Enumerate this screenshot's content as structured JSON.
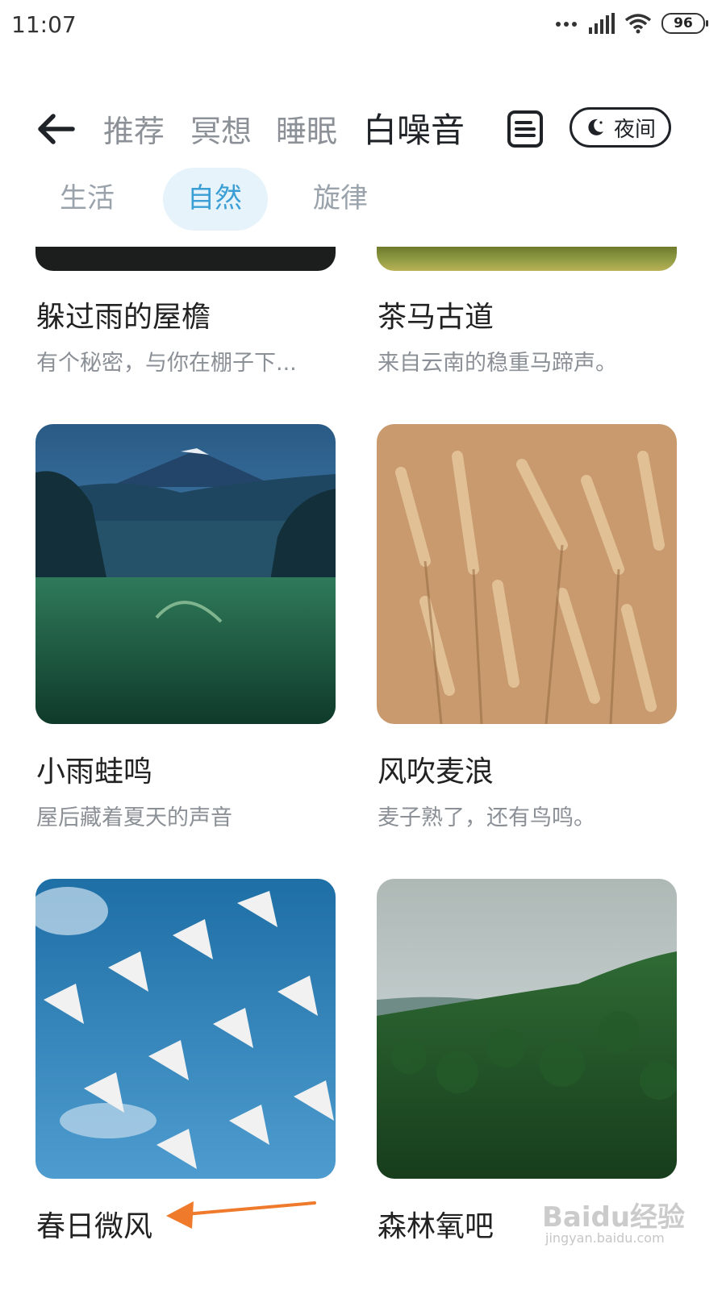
{
  "status_bar": {
    "time": "11:07",
    "battery": "96",
    "icons": [
      "dots-icon",
      "signal-icon",
      "wifi-icon",
      "battery-icon"
    ]
  },
  "header": {
    "tabs": [
      {
        "label": "推荐",
        "active": false
      },
      {
        "label": "冥想",
        "active": false
      },
      {
        "label": "睡眠",
        "active": false
      },
      {
        "label": "白噪音",
        "active": true
      }
    ],
    "night_button_label": "夜间"
  },
  "sub_tabs": [
    {
      "label": "生活",
      "active": false
    },
    {
      "label": "自然",
      "active": true
    },
    {
      "label": "旋律",
      "active": false
    }
  ],
  "cards": [
    {
      "title": "躲过雨的屋檐",
      "desc": "有个秘密，与你在棚子下..."
    },
    {
      "title": "茶马古道",
      "desc": "来自云南的稳重马蹄声。"
    },
    {
      "title": "小雨蛙鸣",
      "desc": "屋后藏着夏天的声音"
    },
    {
      "title": "风吹麦浪",
      "desc": "麦子熟了，还有鸟鸣。"
    },
    {
      "title": "春日微风",
      "desc": ""
    },
    {
      "title": "森林氧吧",
      "desc": ""
    }
  ],
  "colors": {
    "accent": "#3b9fd6",
    "accent_bg": "#e6f3fa",
    "annotation_arrow": "#f07a2c"
  },
  "watermark": {
    "text": "Baidu经验",
    "sub": "jingyan.baidu.com"
  }
}
